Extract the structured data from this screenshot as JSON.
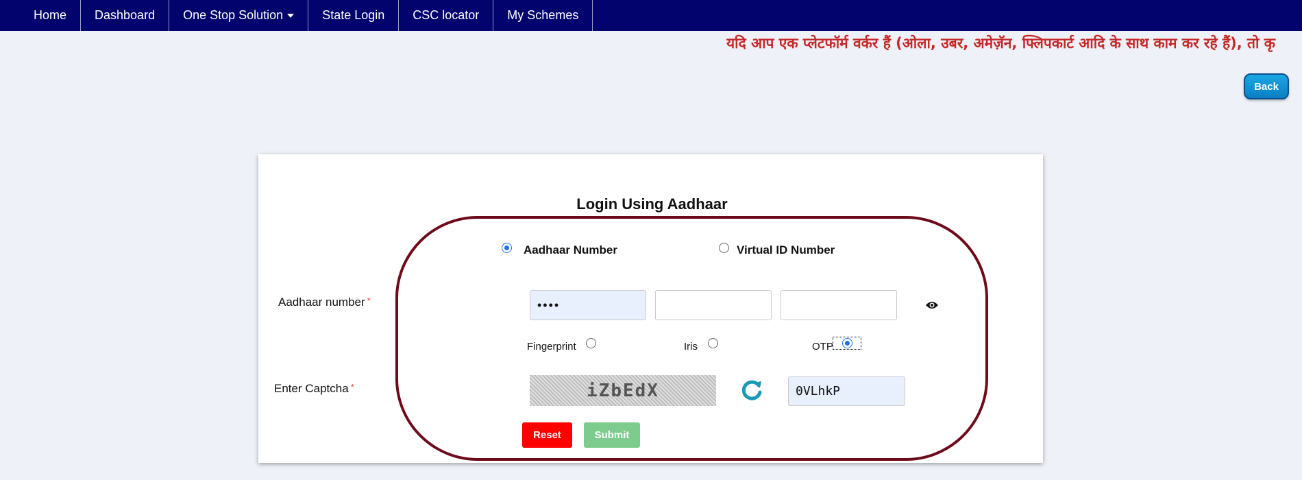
{
  "navbar": {
    "items": [
      {
        "label": "Home"
      },
      {
        "label": "Dashboard"
      },
      {
        "label": "One Stop Solution",
        "dropdown": true
      },
      {
        "label": "State Login"
      },
      {
        "label": "CSC locator"
      },
      {
        "label": "My Schemes"
      }
    ]
  },
  "marquee": {
    "text": "यदि आप एक प्लेटफॉर्म वर्कर हैं (ओला, उबर, अमेज़ॅन, फ्लिपकार्ट आदि के साथ काम कर रहे हैं), तो कृ"
  },
  "back_label": "Back",
  "login": {
    "title": "Login Using Aadhaar",
    "id_types": [
      {
        "label": "Aadhaar Number",
        "selected": true
      },
      {
        "label": "Virtual ID Number",
        "selected": false
      }
    ],
    "aadhaar_label": "Aadhaar number",
    "required_mark": "*",
    "aadhaar_fields": [
      "••••",
      "",
      ""
    ],
    "auth_methods": [
      {
        "label": "Fingerprint",
        "selected": false
      },
      {
        "label": "Iris",
        "selected": false
      },
      {
        "label": "OTP",
        "selected": true
      }
    ],
    "captcha_label": "Enter Captcha",
    "captcha_text": "iZbEdX",
    "captcha_value": "0VLhkP",
    "reset_label": "Reset",
    "submit_label": "Submit"
  },
  "colors": {
    "navbar_bg": "#03036d",
    "marquee_text": "#c62828",
    "ellipse_border": "#6d0b1a",
    "reset_bg": "#ff0000",
    "submit_bg": "#7dcc8e"
  },
  "icons": {
    "dropdown": "caret-down-icon",
    "show_password": "eye-icon",
    "refresh_captcha": "refresh-icon"
  }
}
